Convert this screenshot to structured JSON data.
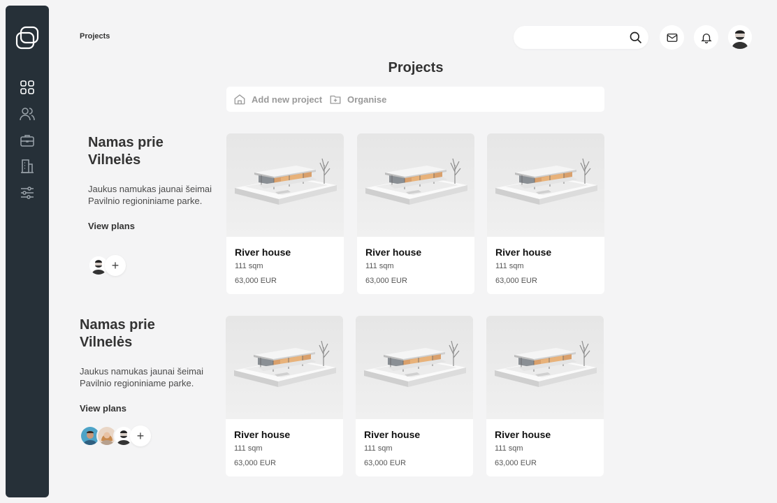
{
  "breadcrumb": "Projects",
  "page_title": "Projects",
  "search": {
    "placeholder": ""
  },
  "toolbar": {
    "add_label": "Add new project",
    "organise_label": "Organise"
  },
  "sidebar": {
    "items": [
      "dashboard-icon",
      "users-icon",
      "briefcase-icon",
      "building-icon",
      "sliders-icon"
    ]
  },
  "sections": [
    {
      "title_line1": "Namas prie",
      "title_line2": "Vilnelės",
      "description": "Jaukus namukas jaunai šeimai Pavilnio regioniniame parke.",
      "view_plans": "View plans",
      "cards": [
        {
          "name": "River house",
          "area": "111 sqm",
          "price": "63,000 EUR"
        },
        {
          "name": "River house",
          "area": "111 sqm",
          "price": "63,000 EUR"
        },
        {
          "name": "River house",
          "area": "111 sqm",
          "price": "63,000 EUR"
        }
      ]
    },
    {
      "title_line1": "Namas prie",
      "title_line2": "Vilnelės",
      "description": "Jaukus namukas jaunai šeimai Pavilnio regioniniame parke.",
      "view_plans": "View plans",
      "cards": [
        {
          "name": "River house",
          "area": "111 sqm",
          "price": "63,000 EUR"
        },
        {
          "name": "River house",
          "area": "111 sqm",
          "price": "63,000 EUR"
        },
        {
          "name": "River house",
          "area": "111 sqm",
          "price": "63,000 EUR"
        }
      ]
    }
  ],
  "colors": {
    "sidebar": "#263038",
    "background": "#f4f4f5",
    "card": "#ffffff",
    "muted_text": "#9a9a9a"
  }
}
